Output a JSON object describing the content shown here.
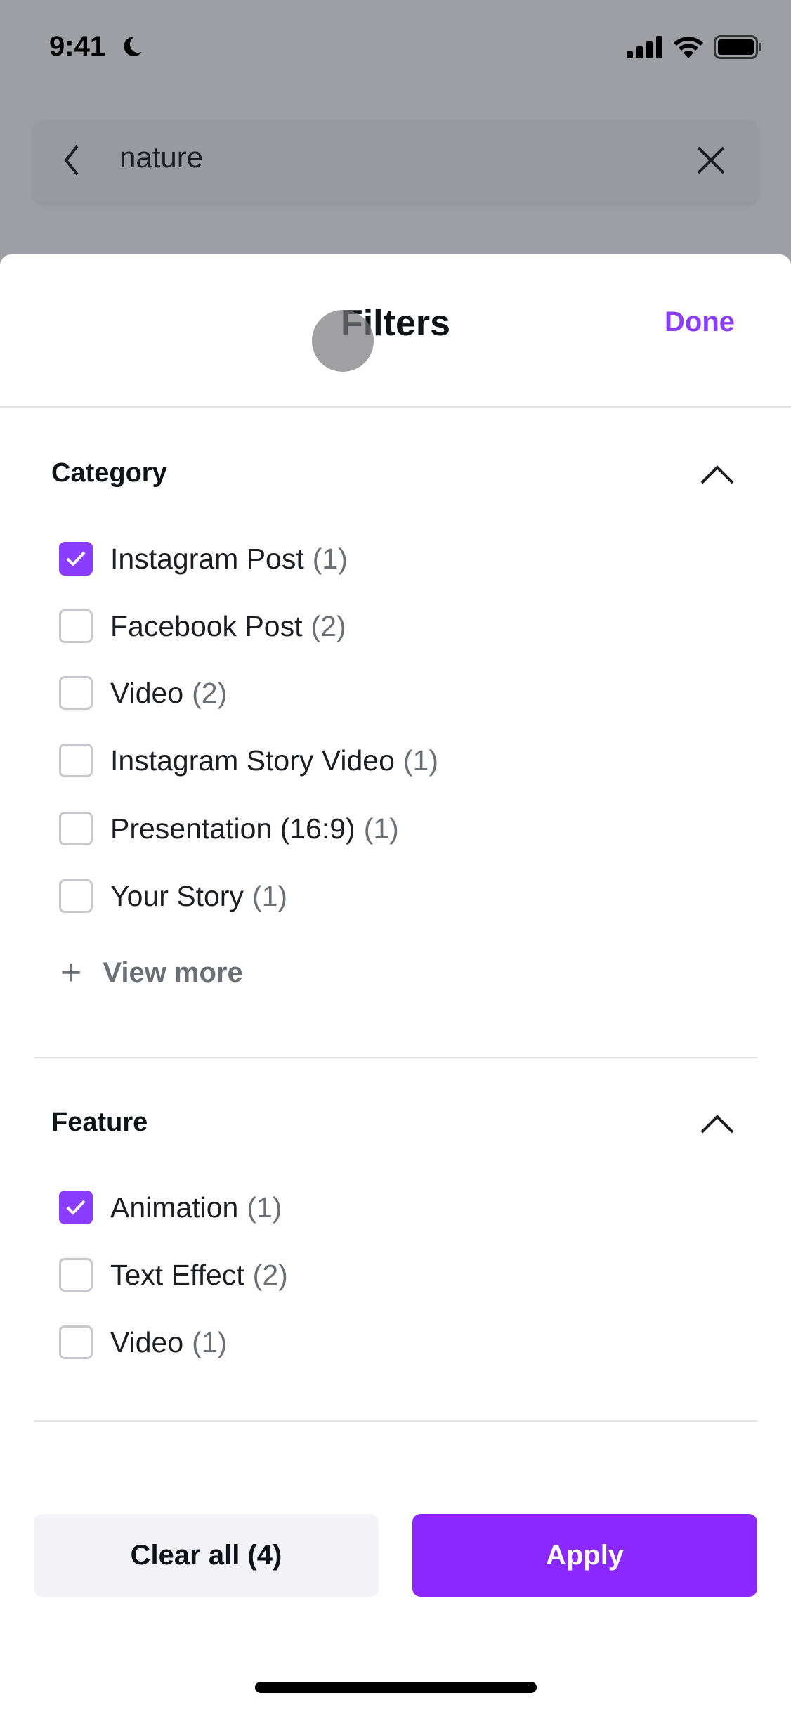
{
  "status_bar": {
    "time": "9:41"
  },
  "search": {
    "query": "nature"
  },
  "sheet": {
    "title": "Filters",
    "done_label": "Done"
  },
  "category": {
    "heading": "Category",
    "items": [
      {
        "label": "Instagram Post",
        "count": "(1)",
        "checked": true
      },
      {
        "label": "Facebook Post",
        "count": "(2)",
        "checked": false
      },
      {
        "label": "Video",
        "count": "(2)",
        "checked": false
      },
      {
        "label": "Instagram Story Video",
        "count": "(1)",
        "checked": false
      },
      {
        "label": "Presentation (16:9)",
        "count": "(1)",
        "checked": false
      },
      {
        "label": "Your Story",
        "count": "(1)",
        "checked": false
      }
    ],
    "view_more": "View more"
  },
  "feature": {
    "heading": "Feature",
    "items": [
      {
        "label": "Animation",
        "count": "(1)",
        "checked": true
      },
      {
        "label": "Text Effect",
        "count": "(2)",
        "checked": false
      },
      {
        "label": "Video",
        "count": "(1)",
        "checked": false
      }
    ]
  },
  "footer": {
    "clear_label": "Clear all (4)",
    "apply_label": "Apply"
  },
  "colors": {
    "accent": "#8b3dff",
    "apply_bg": "#8b27ff",
    "overlay": "#9d9fa4"
  }
}
